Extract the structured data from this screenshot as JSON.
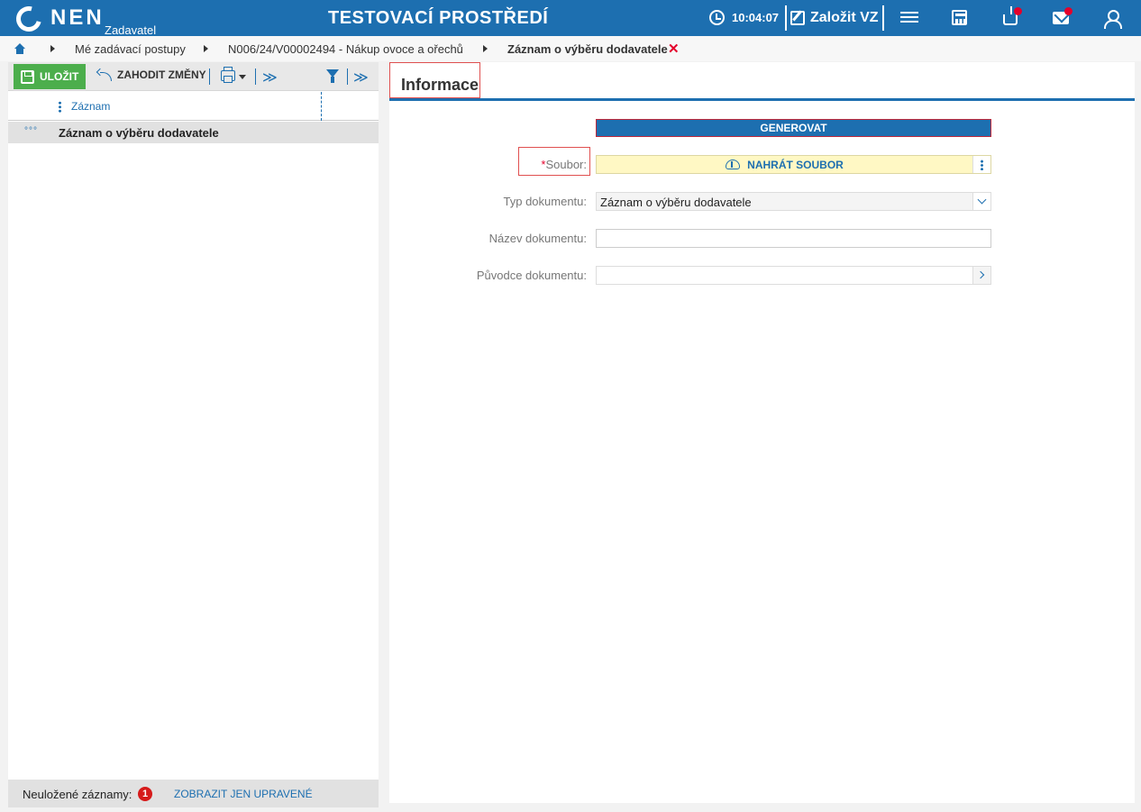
{
  "header": {
    "logo_text": "NEN",
    "logo_sub": "Zadavatel",
    "environment_title": "TESTOVACÍ PROSTŘEDÍ",
    "time": "10:04:07",
    "create_label": "Založit VZ"
  },
  "breadcrumb": {
    "items": [
      "Mé zadávací postupy",
      "N006/24/V00002494 - Nákup ovoce a ořechů",
      "Záznam o výběru dodavatele"
    ],
    "close_symbol": "✕"
  },
  "toolbar": {
    "save_label": "ULOŽIT",
    "discard_label": "ZAHODIT ZMĚNY",
    "expand_symbol": "≫"
  },
  "grid": {
    "column_title": "Záznam",
    "rows": [
      {
        "dots": "°°°",
        "label": "Záznam o výběru dodavatele"
      }
    ]
  },
  "footer": {
    "unsaved_label": "Neuložené záznamy:",
    "unsaved_count": "1",
    "show_edited_label": "ZOBRAZIT JEN UPRAVENÉ"
  },
  "form": {
    "tab_label": "Informace",
    "generate_label": "GENEROVAT",
    "file_label": "Soubor:",
    "required_mark": "*",
    "upload_label": "NAHRÁT SOUBOR",
    "doc_type_label": "Typ dokumentu:",
    "doc_type_value": "Záznam o výběru dodavatele",
    "doc_name_label": "Název dokumentu:",
    "doc_name_value": "",
    "doc_origin_label": "Původce dokumentu:",
    "doc_origin_value": ""
  },
  "colors": {
    "brand_blue": "#1d6fb0",
    "save_green": "#4cae4c",
    "alert_red": "#e4002b",
    "upload_yellow": "#fff8c4"
  }
}
